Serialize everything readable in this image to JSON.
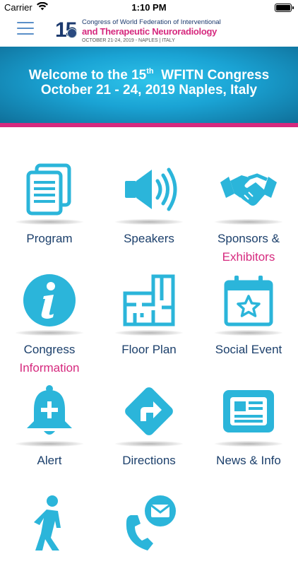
{
  "status_bar": {
    "carrier": "Carrier",
    "time": "1:10 PM"
  },
  "header": {
    "logo": {
      "number": "15",
      "line1": "Congress of World Federation of Interventional",
      "line2": "and Therapeutic Neuroradiology",
      "line3": "OCTOBER 21-24, 2019 - NAPLES | ITALY"
    }
  },
  "banner": {
    "line1_pre": "Welcome to the 15",
    "line1_sup": "th",
    "line1_post": "  WFITN Congress",
    "line2": "October 21 - 24, 2019 Naples, Italy"
  },
  "colors": {
    "accent_blue": "#2bb5da",
    "brand_pink": "#d6297e",
    "label_navy": "#1b3f6b"
  },
  "tiles": [
    {
      "label1": "Program",
      "label2": "",
      "icon": "document-icon"
    },
    {
      "label1": "Speakers",
      "label2": "",
      "icon": "speaker-icon"
    },
    {
      "label1": "Sponsors &",
      "label2": "Exhibitors",
      "icon": "handshake-icon"
    },
    {
      "label1": "Congress",
      "label2": "Information",
      "icon": "info-icon"
    },
    {
      "label1": "Floor Plan",
      "label2": "",
      "icon": "floor-plan-icon"
    },
    {
      "label1": "Social Event",
      "label2": "",
      "icon": "calendar-star-icon"
    },
    {
      "label1": "Alert",
      "label2": "",
      "icon": "bell-plus-icon"
    },
    {
      "label1": "Directions",
      "label2": "",
      "icon": "directions-icon"
    },
    {
      "label1": "News & Info",
      "label2": "",
      "icon": "newspaper-icon"
    },
    {
      "label1": "",
      "label2": "",
      "icon": "walking-person-icon"
    },
    {
      "label1": "",
      "label2": "",
      "icon": "phone-mail-icon"
    }
  ]
}
